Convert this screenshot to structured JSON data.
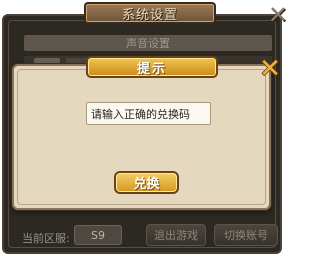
{
  "settings": {
    "title": "系统设置",
    "close_icon": "close-x-icon",
    "sound_header": "声音设置",
    "server_label": "当前区服:",
    "server_value": "S9",
    "exit_label": "退出游戏",
    "switch_label": "切换账号"
  },
  "dialog": {
    "title": "提示",
    "close_icon": "close-x-icon",
    "input_value": "请输入正确的兑换码",
    "redeem_label": "兑换"
  },
  "colors": {
    "gold_accent": "#f2b23a",
    "dialog_bg": "#e4d8bf",
    "panel_bg": "#2c2822"
  }
}
